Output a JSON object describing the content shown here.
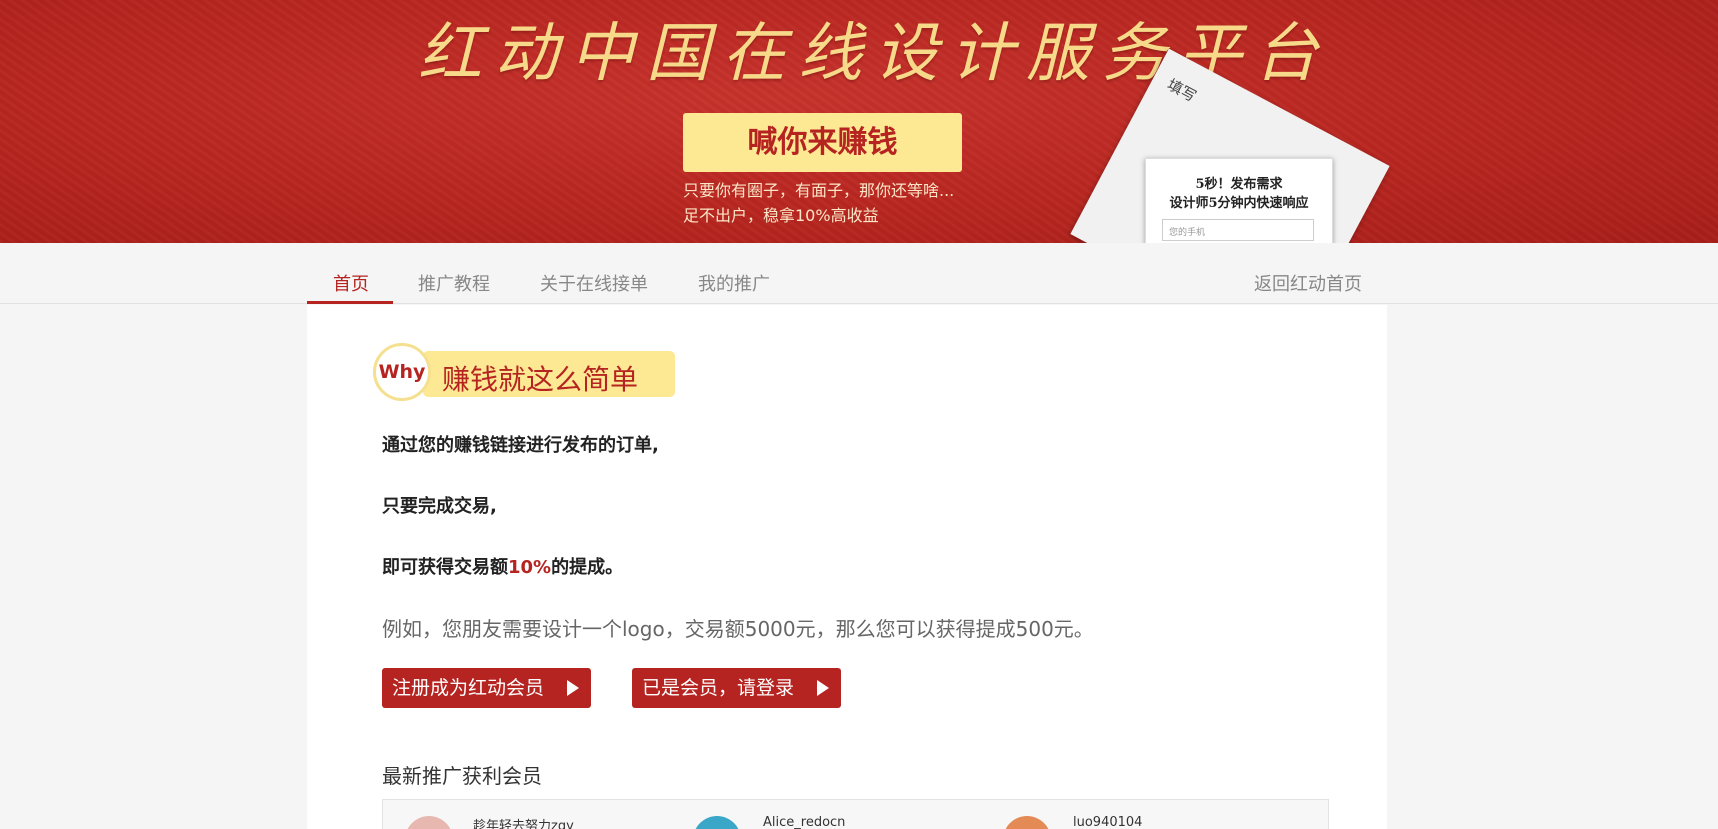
{
  "banner": {
    "title": "红动中国在线设计服务平台",
    "cta": "喊你来赚钱",
    "subline1": "只要你有圈子，有面子，那你还等啥...",
    "subline2": "足不出户，稳拿10%高收益",
    "paper_back_text": "填写",
    "paper_line1": "5秒！发布需求",
    "paper_line2": "设计师5分钟内快速响应",
    "paper_input_placeholder": "您的手机"
  },
  "nav": {
    "items": [
      {
        "label": "首页",
        "active": true
      },
      {
        "label": "推广教程",
        "active": false
      },
      {
        "label": "关于在线接单",
        "active": false
      },
      {
        "label": "我的推广",
        "active": false
      }
    ],
    "back_link": "返回红动首页"
  },
  "why": {
    "badge": "Why",
    "title": "赚钱就这么简单",
    "line1": "通过您的赚钱链接进行发布的订单,",
    "line2": "只要完成交易,",
    "line3_prefix": "即可获得交易额",
    "line3_highlight": "10%",
    "line3_suffix": "的提成。",
    "example": "例如，您朋友需要设计一个logo，交易额5000元，那么您可以获得提成500元。"
  },
  "buttons": {
    "register": "注册成为红动会员",
    "login": "已是会员，请登录"
  },
  "members": {
    "heading": "最新推广获利会员",
    "list": [
      {
        "name": "趁年轻去努力zqy",
        "avatar_color": "#e7b8b0"
      },
      {
        "name": "Alice_redocn",
        "avatar_color": "#3aa6c8"
      },
      {
        "name": "luo940104",
        "avatar_color": "#e38a55"
      }
    ]
  },
  "colors": {
    "brand_red": "#b52420",
    "highlight_yellow": "#fde894"
  }
}
